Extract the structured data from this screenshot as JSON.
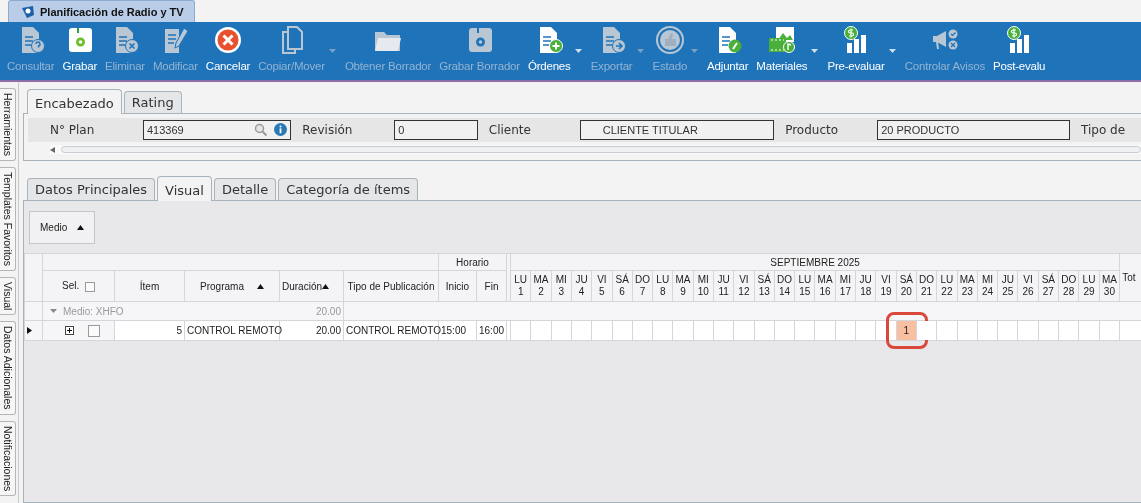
{
  "window": {
    "title": "Planificación de Radio y TV"
  },
  "toolbar": [
    {
      "label": "Consultar",
      "enabled": false,
      "dropdown": false
    },
    {
      "label": "Grabar",
      "enabled": true,
      "dropdown": false
    },
    {
      "label": "Eliminar",
      "enabled": false,
      "dropdown": false
    },
    {
      "label": "Modificar",
      "enabled": false,
      "dropdown": false
    },
    {
      "label": "Cancelar",
      "enabled": true,
      "dropdown": false
    },
    {
      "label": "Copiar/Mover",
      "enabled": false,
      "dropdown": true
    },
    {
      "label": "Obtener Borrador",
      "enabled": false,
      "dropdown": false
    },
    {
      "label": "Grabar Borrador",
      "enabled": false,
      "dropdown": false
    },
    {
      "label": "Órdenes",
      "enabled": true,
      "dropdown": true
    },
    {
      "label": "Exportar",
      "enabled": false,
      "dropdown": true
    },
    {
      "label": "Estado",
      "enabled": false,
      "dropdown": true
    },
    {
      "label": "Adjuntar",
      "enabled": true,
      "dropdown": false
    },
    {
      "label": "Materiales",
      "enabled": true,
      "dropdown": true
    },
    {
      "label": "Pre-evaluar",
      "enabled": true,
      "dropdown": true
    },
    {
      "label": "Controlar Avisos",
      "enabled": false,
      "dropdown": false
    },
    {
      "label": "Post-evalu",
      "enabled": true,
      "dropdown": false
    }
  ],
  "side_tabs": [
    {
      "label": "Herramientas"
    },
    {
      "label": "Templates Favoritos"
    },
    {
      "label": "Visual"
    },
    {
      "label": "Datos Adicionales"
    },
    {
      "label": "Notificaciones"
    }
  ],
  "header_tabs": [
    {
      "label": "Encabezado",
      "selected": true
    },
    {
      "label": "Rating",
      "selected": false
    }
  ],
  "header_fields": [
    {
      "label": "N° Plan",
      "value": "413369",
      "kind": "lookup"
    },
    {
      "label": "Revisión",
      "value": "0",
      "kind": "text"
    },
    {
      "label": "Cliente",
      "value": "CLIENTE TITULAR",
      "kind": "text"
    },
    {
      "label": "Producto",
      "value": "20 PRODUCTO",
      "kind": "text"
    },
    {
      "label": "Tipo de",
      "kind": "label"
    }
  ],
  "detail_tabs": [
    {
      "label": "Datos Principales",
      "selected": false
    },
    {
      "label": "Visual",
      "selected": true
    },
    {
      "label": "Detalle",
      "selected": false
    },
    {
      "label": "Categoría de ítems",
      "selected": false
    }
  ],
  "group_by": {
    "label": "Medio",
    "sort_ascending": true
  },
  "grid": {
    "columns": [
      {
        "label": "Sel.",
        "kind": "check",
        "checked": false
      },
      {
        "label": "Ítem",
        "kind": "plain"
      },
      {
        "label": "Programa",
        "kind": "plain",
        "sort_ascending": true
      },
      {
        "label": "Duración",
        "kind": "plain",
        "sort_ascending": true
      },
      {
        "label": "Tipo de Publicación",
        "kind": "plain"
      },
      {
        "label": "Inicio",
        "kind": "plain"
      },
      {
        "label": "Fin",
        "kind": "plain"
      }
    ],
    "band": "Horario",
    "month": "SEPTIEMBRE 2025",
    "days": [
      {
        "weekday": "LU",
        "day": "1"
      },
      {
        "weekday": "MA",
        "day": "2"
      },
      {
        "weekday": "MI",
        "day": "3"
      },
      {
        "weekday": "JU",
        "day": "4"
      },
      {
        "weekday": "VI",
        "day": "5"
      },
      {
        "weekday": "SÁ",
        "day": "6"
      },
      {
        "weekday": "DO",
        "day": "7"
      },
      {
        "weekday": "LU",
        "day": "8"
      },
      {
        "weekday": "MA",
        "day": "9"
      },
      {
        "weekday": "MI",
        "day": "10"
      },
      {
        "weekday": "JU",
        "day": "11"
      },
      {
        "weekday": "VI",
        "day": "12"
      },
      {
        "weekday": "SÁ",
        "day": "13"
      },
      {
        "weekday": "DO",
        "day": "14"
      },
      {
        "weekday": "LU",
        "day": "15"
      },
      {
        "weekday": "MA",
        "day": "16"
      },
      {
        "weekday": "MI",
        "day": "17"
      },
      {
        "weekday": "JU",
        "day": "18"
      },
      {
        "weekday": "VI",
        "day": "19"
      },
      {
        "weekday": "SÁ",
        "day": "20",
        "spots": [
          {
            "value": "1",
            "circled": true
          }
        ]
      },
      {
        "weekday": "DO",
        "day": "21"
      },
      {
        "weekday": "LU",
        "day": "22"
      },
      {
        "weekday": "MA",
        "day": "23"
      },
      {
        "weekday": "MI",
        "day": "24"
      },
      {
        "weekday": "JU",
        "day": "25"
      },
      {
        "weekday": "VI",
        "day": "26"
      },
      {
        "weekday": "SÁ",
        "day": "27"
      },
      {
        "weekday": "DO",
        "day": "28"
      },
      {
        "weekday": "LU",
        "day": "29"
      },
      {
        "weekday": "MA",
        "day": "30"
      }
    ],
    "total_column": "Tot",
    "group": {
      "label": "Medio: XHFO",
      "expanded": true,
      "total": "20.00"
    },
    "rows": [
      {
        "current": true,
        "expanded": false,
        "checked": false,
        "item": "5",
        "programa": "CONTROL REMOTO",
        "duracion": "20.00",
        "tipo": "CONTROL REMOTO",
        "inicio": "15:00",
        "fin": "16:00"
      }
    ]
  }
}
